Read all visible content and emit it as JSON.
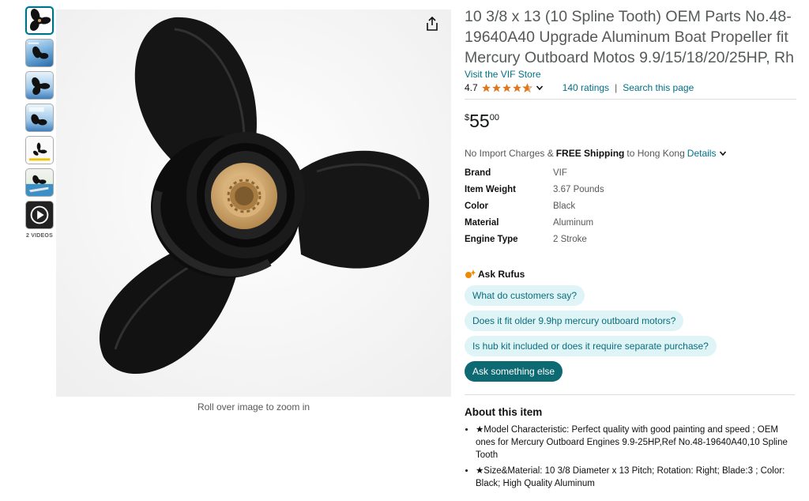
{
  "gallery": {
    "videos_label": "2 VIDEOS",
    "zoom_hint": "Roll over image to zoom in"
  },
  "product": {
    "title": "10 3/8 x 13 (10 Spline Tooth) OEM Parts No.48-19640A40 Upgrade Aluminum Boat Propeller fit Mercury Outboard Motos 9.9/15/18/20/25HP, Rh",
    "store_link": "Visit the VIF Store",
    "rating_value": "4.7",
    "star_rating": 4.7,
    "ratings_count": "140 ratings",
    "separator": "|",
    "search_link": "Search this page",
    "price_symbol": "$",
    "price_whole": "55",
    "price_fraction": "00"
  },
  "shipping": {
    "prefix": "No Import Charges &",
    "free": "FREE Shipping",
    "dest": "to Hong Kong",
    "details": "Details"
  },
  "specs": [
    {
      "key": "Brand",
      "value": "VIF"
    },
    {
      "key": "Item Weight",
      "value": "3.67 Pounds"
    },
    {
      "key": "Color",
      "value": "Black"
    },
    {
      "key": "Material",
      "value": "Aluminum"
    },
    {
      "key": "Engine Type",
      "value": "2 Stroke"
    }
  ],
  "rufus": {
    "title": "Ask Rufus",
    "questions": [
      "What do customers say?",
      "Does it fit older 9.9hp mercury outboard motors?",
      "Is hub kit included or does it require separate purchase?"
    ],
    "ask_button": "Ask something else"
  },
  "about": {
    "title": "About this item",
    "bullets": [
      "★Model Characteristic: Perfect quality with good painting and speed ; OEM ones for Mercury Outboard Engines 9.9-25HP,Ref No.48-19640A40,10 Spline Tooth",
      "★Size&Material: 10 3/8 Diameter x 13 Pitch; Rotation: Right; Blade:3 ; Color: Black; High Quality Aluminum"
    ]
  },
  "colors": {
    "link": "#007185",
    "star": "#de7921",
    "pill_bg": "#dff4f7",
    "pill_dark": "#0d6a73"
  },
  "icons": {
    "share": "share-icon",
    "chevron": "chevron-down-icon",
    "rufus": "rufus-spark-icon",
    "play": "play-icon"
  }
}
